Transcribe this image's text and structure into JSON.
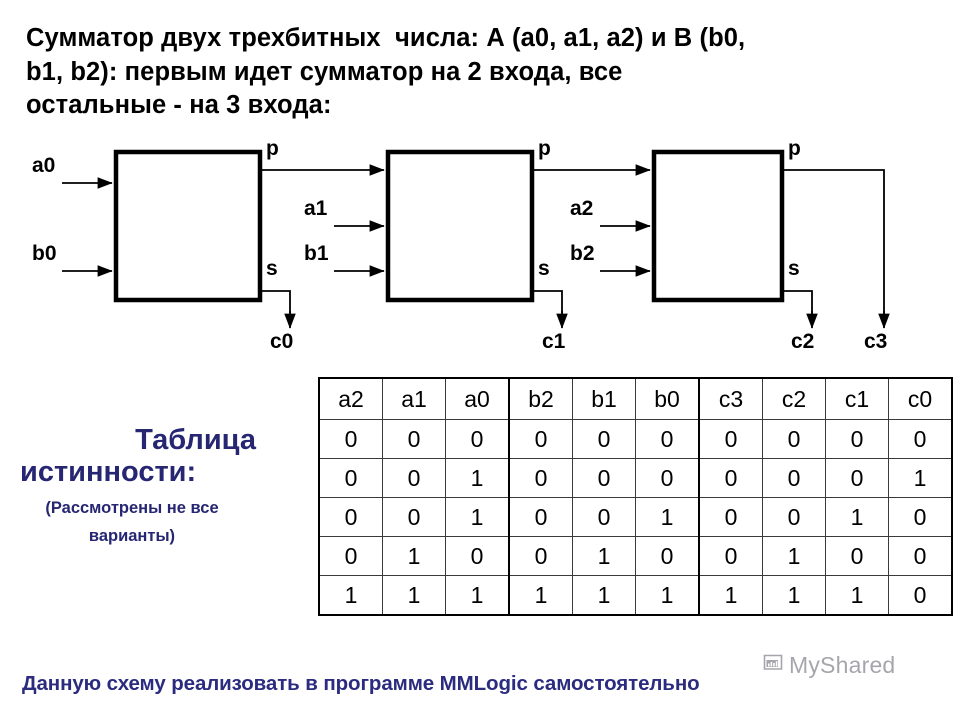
{
  "title": {
    "lines": [
      "Сумматор двух трехбитных  числа: А (a0, a1, a2) и В (b0,",
      "b1, b2): первым идет сумматор на 2 входа, все",
      "остальные - на 3 входа:"
    ]
  },
  "diagram": {
    "blocks": [
      {
        "id": "adder-1",
        "inputs": [
          "a0",
          "b0"
        ],
        "outputs": [
          "p",
          "s"
        ],
        "carry_label": "c0"
      },
      {
        "id": "adder-2",
        "inputs": [
          "a1",
          "b1"
        ],
        "outputs": [
          "p",
          "s"
        ],
        "carry_label": "c1"
      },
      {
        "id": "adder-3",
        "inputs": [
          "a2",
          "b2"
        ],
        "outputs": [
          "p",
          "s"
        ],
        "carry_label": "c2",
        "final_label": "c3"
      }
    ],
    "labels": {
      "a0": "a0",
      "b0": "b0",
      "a1": "a1",
      "b1": "b1",
      "a2": "a2",
      "b2": "b2",
      "p1": "p",
      "s1": "s",
      "p2": "p",
      "s2": "s",
      "p3": "p",
      "s3": "s",
      "c0": "c0",
      "c1": "c1",
      "c2": "c2",
      "c3": "c3"
    }
  },
  "caption": {
    "line1": "Таблица",
    "line2": "истинности:",
    "note1": "(Рассмотрены не все",
    "note2": "варианты)"
  },
  "table": {
    "headers": [
      "a2",
      "a1",
      "a0",
      "b2",
      "b1",
      "b0",
      "c3",
      "c2",
      "c1",
      "c0"
    ],
    "rows": [
      [
        "0",
        "0",
        "0",
        "0",
        "0",
        "0",
        "0",
        "0",
        "0",
        "0"
      ],
      [
        "0",
        "0",
        "1",
        "0",
        "0",
        "0",
        "0",
        "0",
        "0",
        "1"
      ],
      [
        "0",
        "0",
        "1",
        "0",
        "0",
        "1",
        "0",
        "0",
        "1",
        "0"
      ],
      [
        "0",
        "1",
        "0",
        "0",
        "1",
        "0",
        "0",
        "1",
        "0",
        "0"
      ],
      [
        "1",
        "1",
        "1",
        "1",
        "1",
        "1",
        "1",
        "1",
        "1",
        "0"
      ]
    ]
  },
  "footer": {
    "text": "Данную схему реализовать в программе MMLogic самостоятельно"
  },
  "watermark": {
    "text": "MyShared",
    "icon": "presentation-icon"
  },
  "colors": {
    "caption": "#262673",
    "footer": "#2b2b80",
    "diagram_stroke": "#000000",
    "table_border": "#3a3a3a",
    "watermark": "#6f6f7a"
  }
}
